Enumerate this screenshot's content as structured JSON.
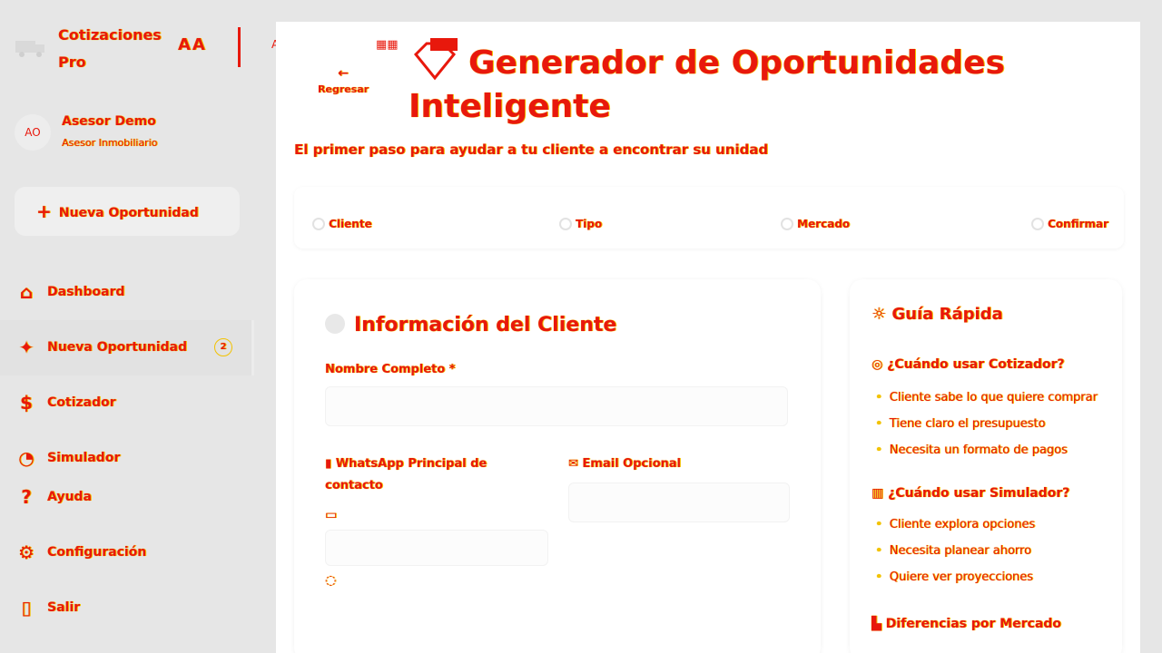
{
  "app": {
    "brand_line1": "Cotizaciones",
    "brand_line2": "Pro",
    "brand_controls": "AA",
    "brand_frame_letter": "A"
  },
  "user": {
    "initials": "AO",
    "name": "Asesor Demo",
    "role": "Asesor Inmobiliario"
  },
  "sidebar": {
    "new_button_label": "Nueva Oportunidad",
    "items": [
      {
        "label": "Dashboard",
        "icon": "home-icon"
      },
      {
        "label": "Nueva Oportunidad",
        "icon": "sparkle-icon",
        "badge": "2"
      },
      {
        "label": "Cotizador",
        "icon": "money-icon"
      },
      {
        "label": "Simulador",
        "icon": "chart-icon"
      }
    ],
    "bottom_items": [
      {
        "label": "Ayuda",
        "icon": "help-icon"
      },
      {
        "label": "Configuración",
        "icon": "gear-icon"
      },
      {
        "label": "Salir",
        "icon": "exit-icon"
      }
    ]
  },
  "header": {
    "back_label": "Regresar",
    "title_line1": "Generador de Oportunidades",
    "title_line2": "Inteligente",
    "subtitle": "El primer paso para ayudar a tu cliente a encontrar su unidad"
  },
  "steps": [
    {
      "label": "Cliente"
    },
    {
      "label": "Tipo"
    },
    {
      "label": "Mercado"
    },
    {
      "label": "Confirmar"
    }
  ],
  "form": {
    "title": "Información del Cliente",
    "name_label": "Nombre Completo *",
    "whatsapp_label": "WhatsApp Principal de contacto",
    "email_label": "Email Opcional"
  },
  "guide": {
    "title": "Guía Rápida",
    "cotizador_heading": "¿Cuándo usar Cotizador?",
    "cotizador_items": [
      "Cliente sabe lo que quiere comprar",
      "Tiene claro el presupuesto",
      "Necesita un formato de pagos"
    ],
    "simulador_heading": "¿Cuándo usar Simulador?",
    "simulador_items": [
      "Cliente explora opciones",
      "Necesita planear ahorro",
      "Quiere ver proyecciones"
    ],
    "mercado_heading": "Diferencias por Mercado"
  }
}
